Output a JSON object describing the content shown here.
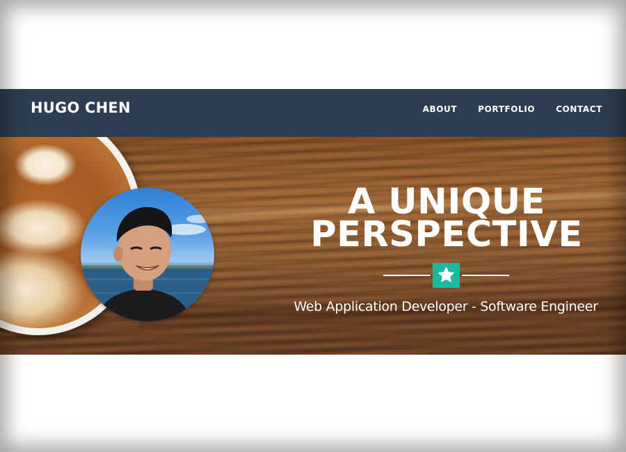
{
  "header": {
    "brand": "HUGO CHEN",
    "nav": [
      {
        "label": "ABOUT"
      },
      {
        "label": "PORTFOLIO"
      },
      {
        "label": "CONTACT"
      }
    ]
  },
  "hero": {
    "title_line1": "A UNIQUE",
    "title_line2": "PERSPECTIVE",
    "subtitle": "Web Application Developer - Software Engineer",
    "divider_icon": "star-icon"
  },
  "colors": {
    "navbar": "#2c3e50",
    "accent": "#18bc9c",
    "text": "#ffffff"
  }
}
